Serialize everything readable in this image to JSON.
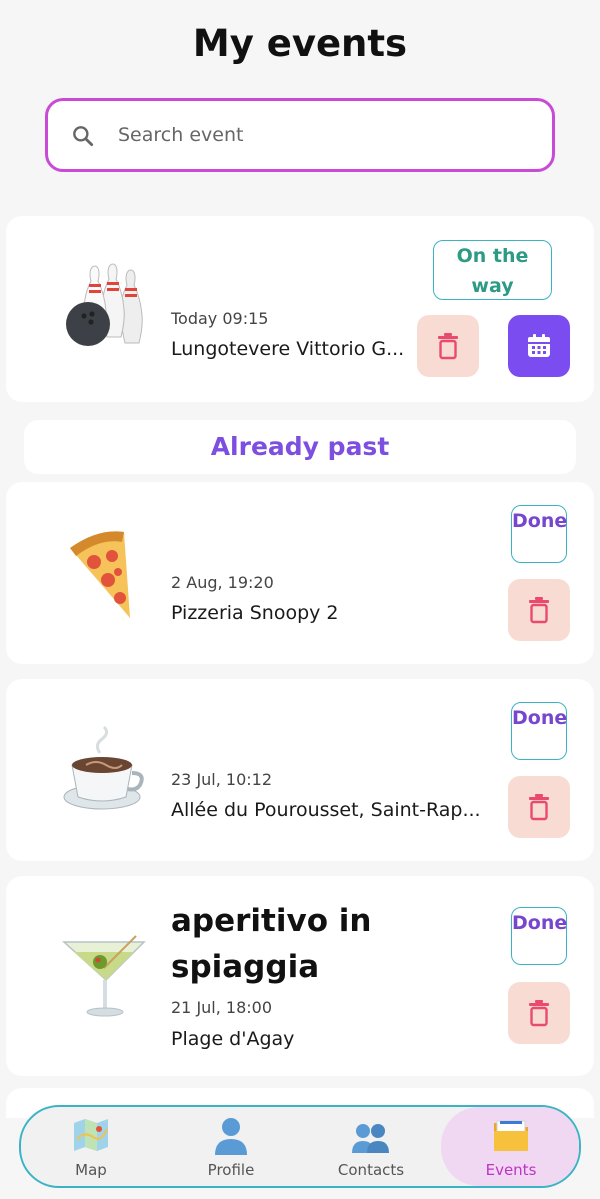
{
  "page": {
    "title": "My events"
  },
  "search": {
    "placeholder": "Search event",
    "value": ""
  },
  "upcoming": [
    {
      "emoji": "bowling-icon",
      "date": "Today 09:15",
      "place": "Lungotevere Vittorio G...",
      "status": "On the way"
    }
  ],
  "past_section": {
    "label": "Already past"
  },
  "past": [
    {
      "emoji": "pizza-icon",
      "date": "2 Aug, 19:20",
      "place": "Pizzeria Snoopy 2",
      "status": "Done"
    },
    {
      "emoji": "coffee-icon",
      "date": "23 Jul, 10:12",
      "place": "Allée du Pourousset, Saint-Rap...",
      "status": "Done"
    },
    {
      "emoji": "cocktail-icon",
      "title": "aperitivo in spiaggia",
      "date": "21 Jul, 18:00",
      "place": "Plage d'Agay",
      "status": "Done"
    }
  ],
  "nav": [
    {
      "label": "Map",
      "icon": "map-icon",
      "active": false
    },
    {
      "label": "Profile",
      "icon": "profile-icon",
      "active": false
    },
    {
      "label": "Contacts",
      "icon": "contacts-icon",
      "active": false
    },
    {
      "label": "Events",
      "icon": "events-folder-icon",
      "active": true
    }
  ],
  "colors": {
    "accent": "#7b4cf0",
    "search_border": "#c94ad6",
    "nav_border": "#3bb3c5",
    "trash_bg": "#f8dcd3",
    "done_text": "#7746cf",
    "way_text": "#2c9a84"
  }
}
